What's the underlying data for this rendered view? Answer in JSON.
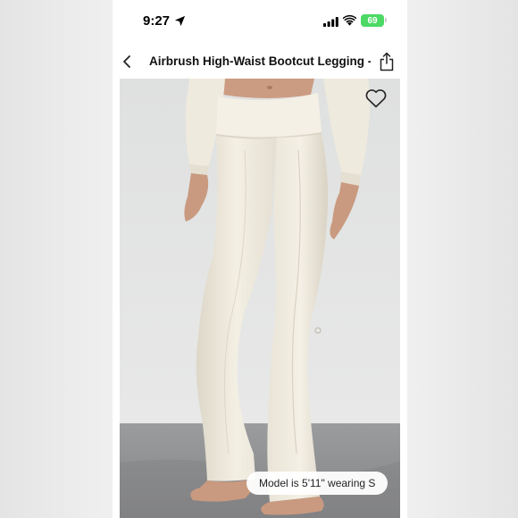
{
  "status_bar": {
    "time": "9:27",
    "battery_level": "69"
  },
  "nav": {
    "title": "Airbrush High-Waist Bootcut Legging - I...",
    "back_icon": "chevron-left-icon",
    "share_icon": "share-icon"
  },
  "product": {
    "image_subject": "model wearing ivory bootcut leggings and cropped sweatshirt",
    "favorite_icon": "heart-outline-icon",
    "model_caption": "Model is 5'11\" wearing S"
  },
  "colors": {
    "battery": "#4cd964",
    "legging": "#f1ede1",
    "floor": "#8e8f91"
  }
}
